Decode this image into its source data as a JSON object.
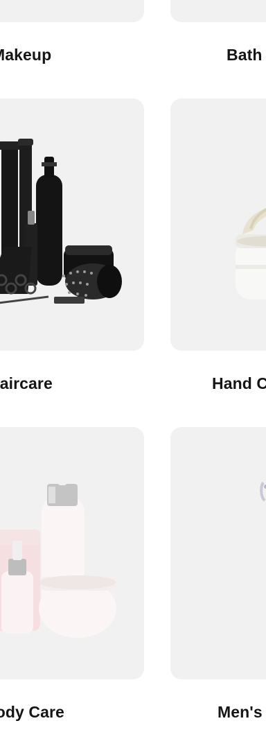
{
  "categories": [
    {
      "label": "Makeup"
    },
    {
      "label": "Bath & Body"
    },
    {
      "label": "Haircare"
    },
    {
      "label": "Hand Care"
    },
    {
      "label": "Body Care"
    },
    {
      "label": "Men's Grooming"
    }
  ]
}
